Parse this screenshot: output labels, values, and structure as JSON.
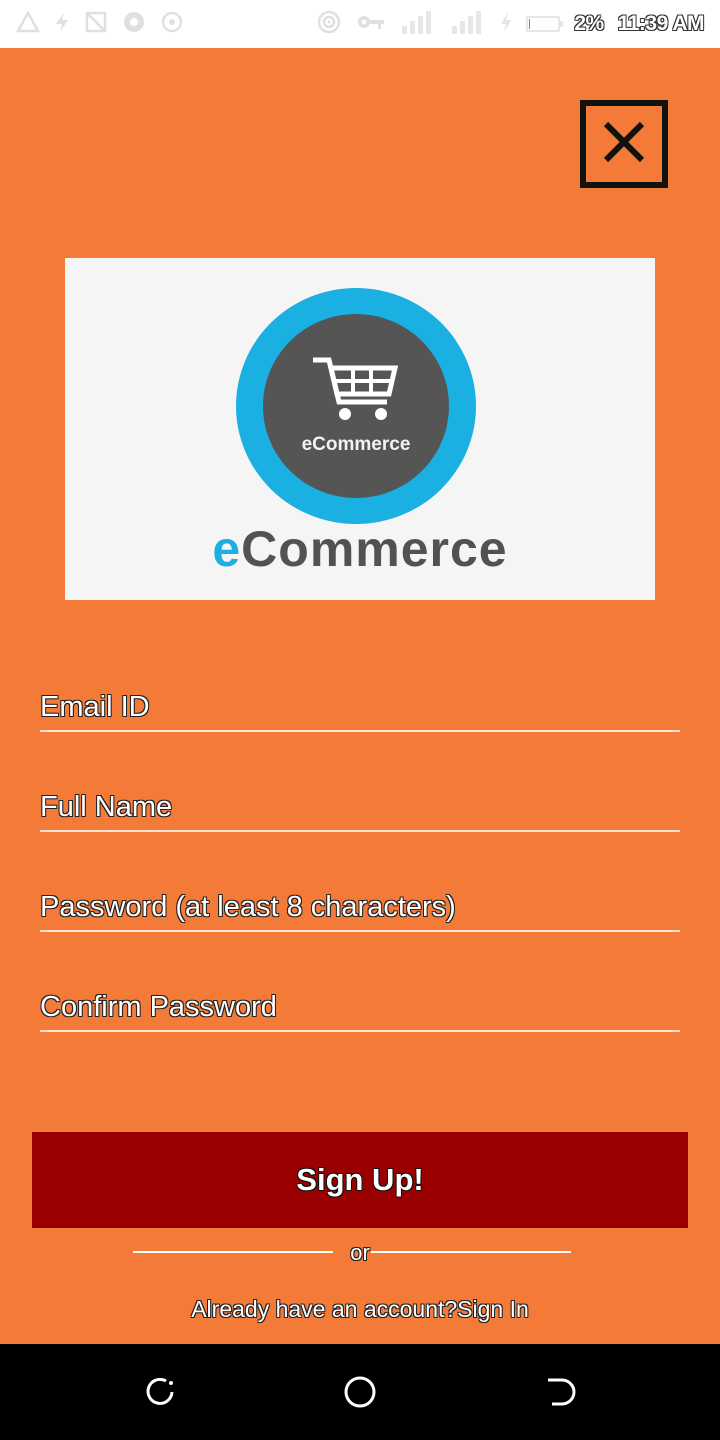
{
  "status_bar": {
    "left_icons": [
      "warning-icon",
      "flash-icon",
      "no-sim-icon",
      "chrome-icon",
      "record-icon"
    ],
    "right_icons": [
      "hotspot-icon",
      "vpn-key-icon",
      "signal-1-icon",
      "signal-2-icon",
      "charging-icon"
    ],
    "battery_level": 0.02,
    "battery_text": "2%",
    "time": "11:39 AM"
  },
  "logo": {
    "inner_text": "eCommerce",
    "wordmark_accent": "e",
    "wordmark_rest": "Commerce"
  },
  "form": {
    "email_label": "Email ID",
    "full_name_label": "Full Name",
    "password_label": "Password (at least 8 characters)",
    "confirm_password_label": "Confirm Password"
  },
  "signup_button": "Sign Up!",
  "divider_text": "or",
  "signin": {
    "prompt": "Already have an account?",
    "link": "Sign In"
  },
  "nav_bar": {
    "buttons": [
      "recents-icon",
      "home-icon",
      "back-icon"
    ]
  },
  "colors": {
    "background": "#f47a38",
    "button": "#9b0000",
    "logo_blue": "#1ab0e2",
    "logo_gray": "#555555",
    "nav": "#000000"
  }
}
